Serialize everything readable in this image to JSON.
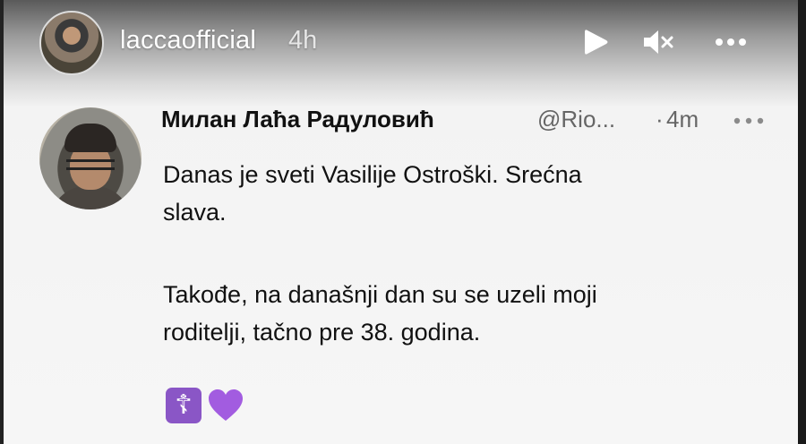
{
  "story": {
    "username": "laccaofficial",
    "time": "4h",
    "icons": [
      "play-icon",
      "mute-icon",
      "more-icon"
    ]
  },
  "tweet": {
    "author_name": "Милан Лаћа Радуловић",
    "handle": "@Rio...",
    "separator": "·",
    "time": "4m",
    "text_line1": "Danas je sveti Vasilije Ostroški. Srećna",
    "text_line2": "slava.",
    "text_line3": "Takođe, na današnji dan su se uzeli moji",
    "text_line4": "roditelji, tačno pre 38. godina.",
    "emoji_1": "☦",
    "emoji_2_name": "purple-heart-icon"
  },
  "colors": {
    "text_primary": "#111111",
    "text_secondary": "#666666",
    "emoji_purple": "#8a56c6",
    "heart_purple": "#a25ce0"
  }
}
